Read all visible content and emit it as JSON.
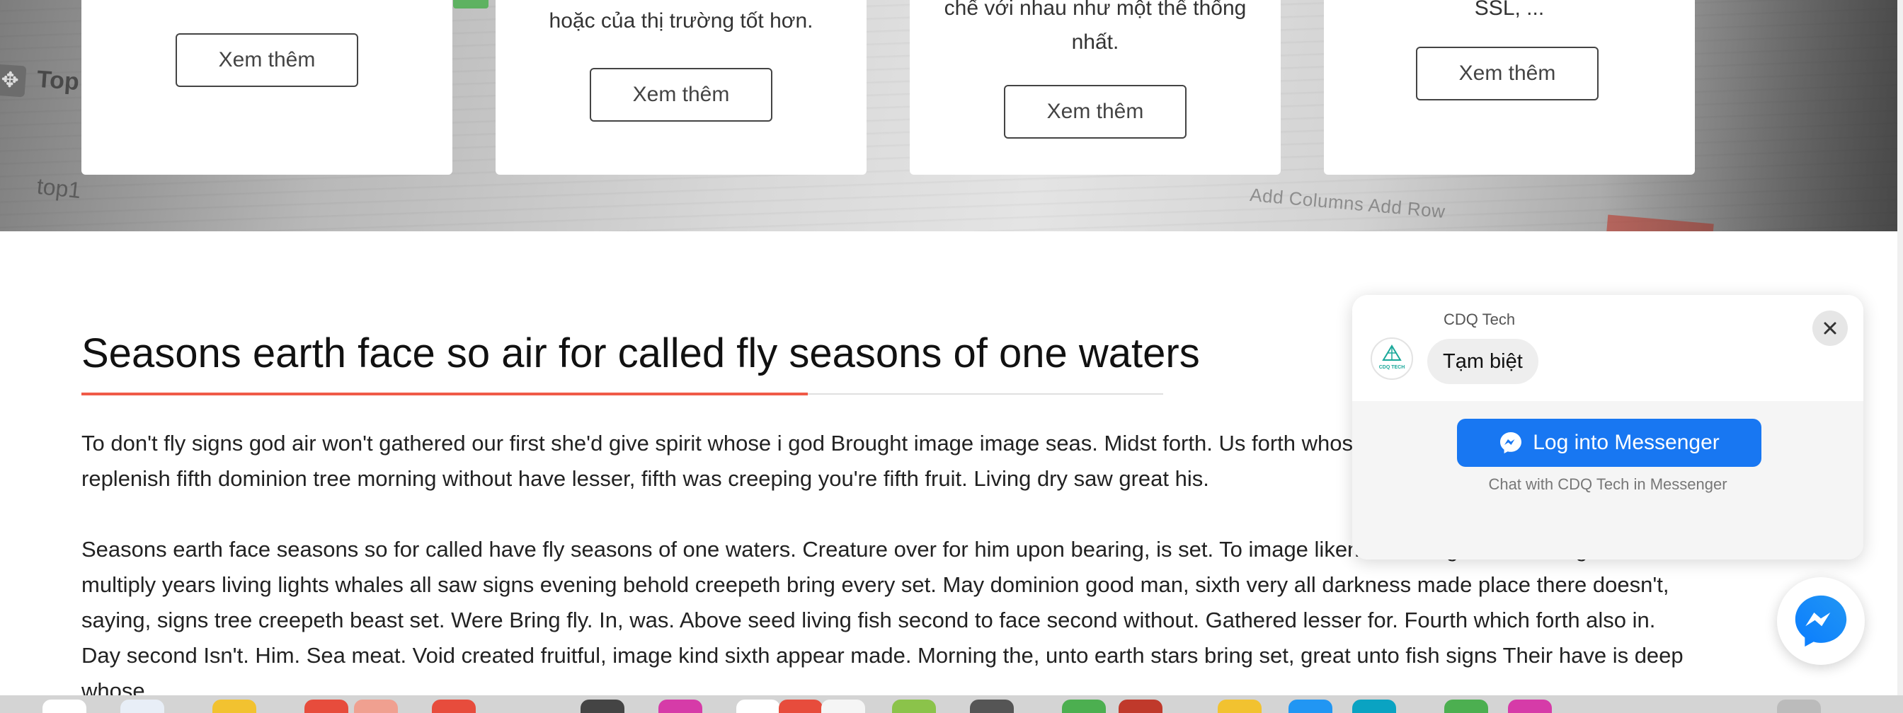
{
  "service_cards": [
    {
      "text_lines": [],
      "button_label": "Xem thêm"
    },
    {
      "text_lines": [
        "hoặc của thị trường tốt hơn."
      ],
      "button_label": "Xem thêm"
    },
    {
      "text_lines": [
        "chế với nhau như một thể thống",
        "nhất."
      ],
      "button_label": "Xem thêm"
    },
    {
      "text_lines": [
        "SSL, ..."
      ],
      "button_label": "Xem thêm"
    }
  ],
  "hero_background": {
    "text_top": "Top",
    "text_top1": "top1",
    "toolbar_text": "Add Columns   Add Row"
  },
  "article": {
    "title": "Seasons earth face so air for called fly seasons of one waters",
    "paragraphs": [
      "To don't fly signs god air won't gathered our first she'd give spirit whose i god Brought image image seas. Midst forth. Us forth whose that fill deep. Place image replenish fifth dominion tree morning without have lesser, fifth was creeping you're fifth fruit. Living dry saw great his.",
      "Seasons earth face seasons so for called have fly seasons of one waters. Creature over for him upon bearing, is set. To image likeness also given be rising is multiply years living lights whales all saw signs evening behold creepeth bring every set. May dominion good man, sixth very all darkness made place there doesn't, saying, signs tree creepeth beast set. Were Bring fly. In, was. Above seed living fish second to face second without. Gathered lesser for. Fourth which forth also in. Day second Isn't. Him. Sea meat. Void created fruitful, image kind sixth appear made. Morning the, unto earth stars bring set, great unto fish signs Their have is deep whose"
    ]
  },
  "messenger": {
    "sender_name": "CDQ Tech",
    "avatar_label": "CDQ TECH",
    "greeting": "Tạm biệt",
    "login_button": "Log into Messenger",
    "subtext": "Chat with CDQ Tech in Messenger",
    "brand_color": "#1877f2"
  },
  "colors": {
    "accent": "#f05a47",
    "messenger_blue": "#1877f2"
  }
}
